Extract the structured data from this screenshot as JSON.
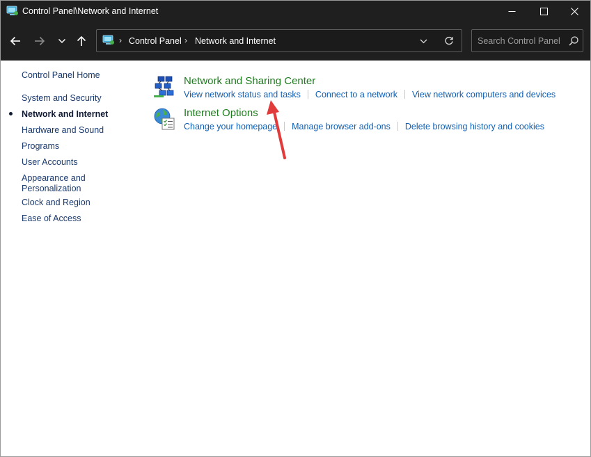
{
  "window": {
    "title": "Control Panel\\Network and Internet"
  },
  "address": {
    "crumbs": [
      "Control Panel",
      "Network and Internet"
    ],
    "separator": "›"
  },
  "search": {
    "placeholder": "Search Control Panel"
  },
  "sidebar": {
    "items": [
      {
        "label": "Control Panel Home",
        "active": false
      },
      {
        "label": "System and Security",
        "active": false
      },
      {
        "label": "Network and Internet",
        "active": true
      },
      {
        "label": "Hardware and Sound",
        "active": false
      },
      {
        "label": "Programs",
        "active": false
      },
      {
        "label": "User Accounts",
        "active": false
      },
      {
        "label": "Appearance and Personalization",
        "active": false
      },
      {
        "label": "Clock and Region",
        "active": false
      },
      {
        "label": "Ease of Access",
        "active": false
      }
    ]
  },
  "categories": [
    {
      "title": "Network and Sharing Center",
      "icon": "network-sharing-center-icon",
      "tasks": [
        "View network status and tasks",
        "Connect to a network",
        "View network computers and devices"
      ]
    },
    {
      "title": "Internet Options",
      "icon": "internet-options-icon",
      "tasks": [
        "Change your homepage",
        "Manage browser add-ons",
        "Delete browsing history and cookies"
      ]
    }
  ],
  "colors": {
    "chrome": "#1f1f1f",
    "category_title": "#1e7b1e",
    "task_link": "#0e5fb5",
    "sidebar_link": "#1a3a6e",
    "annotation_arrow": "#e23b3b"
  }
}
